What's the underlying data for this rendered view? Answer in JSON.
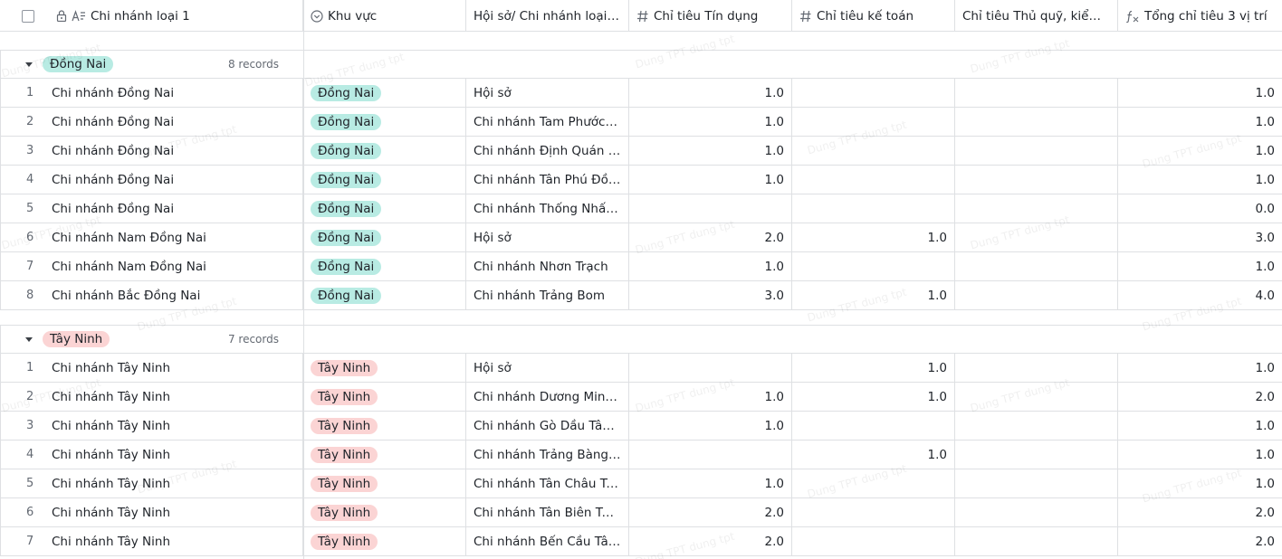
{
  "header": {
    "columns": [
      {
        "label": "Chi nhánh loại 1",
        "icon": "text-lock-icon"
      },
      {
        "label": "Khu vực",
        "icon": "single-select-icon"
      },
      {
        "label": "Hội sở/ Chi nhánh loại I...",
        "icon": ""
      },
      {
        "label": "Chỉ tiêu Tín dụng",
        "icon": "number-icon"
      },
      {
        "label": "Chỉ tiêu kế toán",
        "icon": "number-icon"
      },
      {
        "label": "Chỉ tiêu Thủ quỹ, kiểm ...",
        "icon": ""
      },
      {
        "label": "Tổng chỉ tiêu 3 vị trí",
        "icon": "formula-icon"
      }
    ]
  },
  "watermark": "Dung TPT dung tpt",
  "colors": {
    "dong_nai_tag": "#b8ebe3",
    "tay_ninh_tag": "#fbd4d4",
    "border": "#dee0e3"
  },
  "groups": [
    {
      "name": "Đồng Nai",
      "count": "8 records",
      "rows": [
        {
          "n": "1",
          "branch": "Chi nhánh Đồng Nai",
          "region": "Đồng Nai",
          "sub": "Hội sở",
          "credit": "1.0",
          "acct": "",
          "cashier": "",
          "total": "1.0"
        },
        {
          "n": "2",
          "branch": "Chi nhánh Đồng Nai",
          "region": "Đồng Nai",
          "sub": "Chi nhánh Tam Phước Đ...",
          "credit": "1.0",
          "acct": "",
          "cashier": "",
          "total": "1.0"
        },
        {
          "n": "3",
          "branch": "Chi nhánh Đồng Nai",
          "region": "Đồng Nai",
          "sub": "Chi nhánh Định Quán Đ...",
          "credit": "1.0",
          "acct": "",
          "cashier": "",
          "total": "1.0"
        },
        {
          "n": "4",
          "branch": "Chi nhánh Đồng Nai",
          "region": "Đồng Nai",
          "sub": "Chi nhánh Tân Phú Đồn...",
          "credit": "1.0",
          "acct": "",
          "cashier": "",
          "total": "1.0"
        },
        {
          "n": "5",
          "branch": "Chi nhánh Đồng Nai",
          "region": "Đồng Nai",
          "sub": "Chi nhánh Thống Nhất ...",
          "credit": "",
          "acct": "",
          "cashier": "",
          "total": "0.0"
        },
        {
          "n": "6",
          "branch": "Chi nhánh Nam Đồng Nai",
          "region": "Đồng Nai",
          "sub": "Hội sở",
          "credit": "2.0",
          "acct": "1.0",
          "cashier": "",
          "total": "3.0"
        },
        {
          "n": "7",
          "branch": "Chi nhánh Nam Đồng Nai",
          "region": "Đồng Nai",
          "sub": "Chi nhánh Nhơn Trạch",
          "credit": "1.0",
          "acct": "",
          "cashier": "",
          "total": "1.0"
        },
        {
          "n": "8",
          "branch": "Chi nhánh Bắc Đồng Nai",
          "region": "Đồng Nai",
          "sub": "Chi nhánh Trảng Bom",
          "credit": "3.0",
          "acct": "1.0",
          "cashier": "",
          "total": "4.0"
        }
      ]
    },
    {
      "name": "Tây Ninh",
      "count": "7 records",
      "rows": [
        {
          "n": "1",
          "branch": "Chi nhánh Tây Ninh",
          "region": "Tây Ninh",
          "sub": "Hội sở",
          "credit": "",
          "acct": "1.0",
          "cashier": "",
          "total": "1.0"
        },
        {
          "n": "2",
          "branch": "Chi nhánh Tây Ninh",
          "region": "Tây Ninh",
          "sub": "Chi nhánh Dương Minh ...",
          "credit": "1.0",
          "acct": "1.0",
          "cashier": "",
          "total": "2.0"
        },
        {
          "n": "3",
          "branch": "Chi nhánh Tây Ninh",
          "region": "Tây Ninh",
          "sub": "Chi nhánh Gò Dầu Tây ...",
          "credit": "1.0",
          "acct": "",
          "cashier": "",
          "total": "1.0"
        },
        {
          "n": "4",
          "branch": "Chi nhánh Tây Ninh",
          "region": "Tây Ninh",
          "sub": "Chi nhánh Trảng Bàng T...",
          "credit": "",
          "acct": "1.0",
          "cashier": "",
          "total": "1.0"
        },
        {
          "n": "5",
          "branch": "Chi nhánh Tây Ninh",
          "region": "Tây Ninh",
          "sub": "Chi nhánh Tân Châu Tâ...",
          "credit": "1.0",
          "acct": "",
          "cashier": "",
          "total": "1.0"
        },
        {
          "n": "6",
          "branch": "Chi nhánh Tây Ninh",
          "region": "Tây Ninh",
          "sub": "Chi nhánh Tân Biên Tây...",
          "credit": "2.0",
          "acct": "",
          "cashier": "",
          "total": "2.0"
        },
        {
          "n": "7",
          "branch": "Chi nhánh Tây Ninh",
          "region": "Tây Ninh",
          "sub": "Chi nhánh Bến Cầu Tây ...",
          "credit": "2.0",
          "acct": "",
          "cashier": "",
          "total": "2.0"
        }
      ]
    }
  ]
}
